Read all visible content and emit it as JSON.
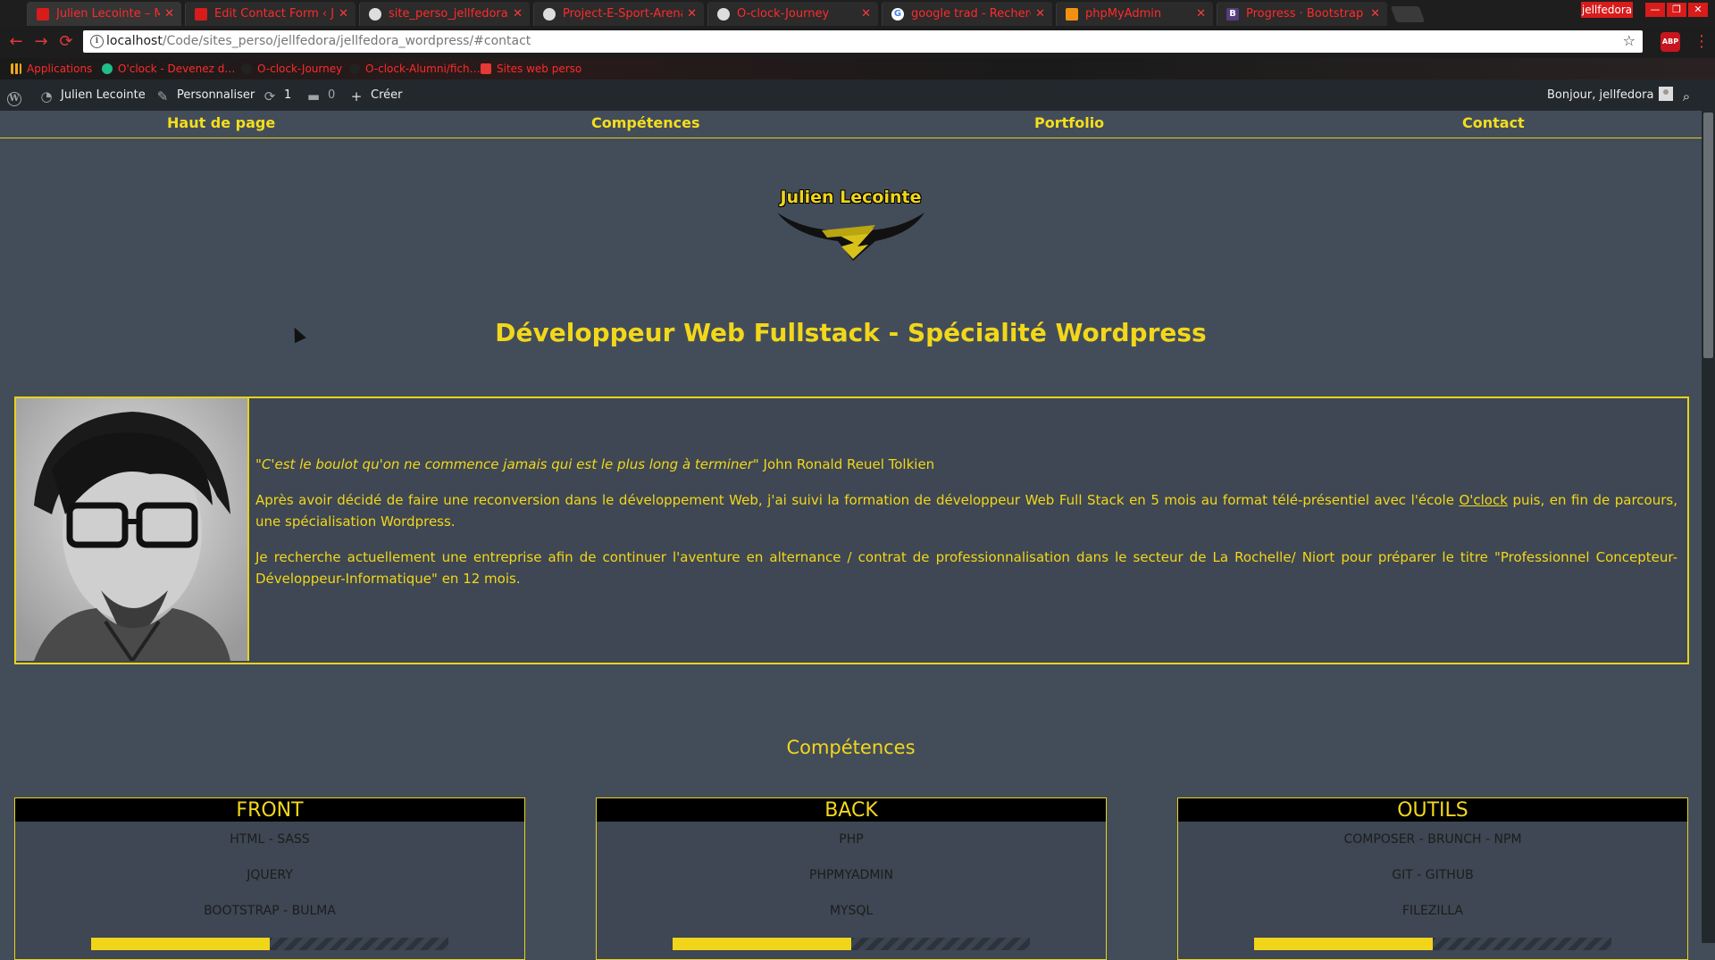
{
  "browser": {
    "tabs": [
      {
        "label": "Julien Lecointe – Mon site",
        "color": "#d81b1b"
      },
      {
        "label": "Edit Contact Form ‹ Julien",
        "color": "#d81b1b"
      },
      {
        "label": "site_perso_jellfedora/jellf",
        "color": "#dddddd"
      },
      {
        "label": "Project-E-Sport-Arena/",
        "color": "#dddddd"
      },
      {
        "label": "O-clock-Journey",
        "color": "#dddddd"
      },
      {
        "label": "google trad - Recherche",
        "color": "#4285f4"
      },
      {
        "label": "phpMyAdmin",
        "color": "#f29111"
      },
      {
        "label": "Progress · Bootstrap",
        "color": "#563d7c"
      }
    ],
    "profile": "jellfedora",
    "url_host": "localhost",
    "url_path": "/Code/sites_perso/jellfedora/jellfedora_wordpress/#contact",
    "abp_label": "ABP",
    "bookmarks": [
      {
        "label": "Applications",
        "color": "#f2a71b"
      },
      {
        "label": "O'clock - Devenez d…",
        "color": "#1ebd8a"
      },
      {
        "label": "O-clock-Journey",
        "color": "#222222"
      },
      {
        "label": "O-clock-Alumni/fich…",
        "color": "#222222"
      },
      {
        "label": "Sites web perso",
        "color": "#e53935"
      }
    ]
  },
  "adminbar": {
    "site_name": "Julien Lecointe",
    "customize": "Personnaliser",
    "updates": "1",
    "comments": "0",
    "create": "Créer",
    "greeting": "Bonjour, jellfedora"
  },
  "nav": {
    "items": [
      "Haut de page",
      "Compétences",
      "Portfolio",
      "Contact"
    ]
  },
  "logo_text": "Julien Lecointe",
  "headline": "Développeur Web Fullstack - Spécialité Wordpress",
  "bio": {
    "quote": "\"C'est le boulot qu'on ne commence jamais qui est le plus long à terminer\"",
    "quote_author": " John Ronald Reuel Tolkien",
    "para1_before": "Après avoir décidé de faire une reconversion dans le développement Web, j'ai suivi la formation de développeur Web Full Stack en 5 mois au format télé-présentiel avec l'école ",
    "para1_link": "O'clock",
    "para1_after": " puis, en fin de parcours, une spécialisation Wordpress.",
    "para2": "Je recherche actuellement une entreprise afin de continuer l'aventure en alternance / contrat de professionnalisation dans le secteur de La Rochelle/ Niort pour préparer le titre \"Professionnel Concepteur-Développeur-Informatique\" en 12 mois."
  },
  "skills": {
    "title": "Compétences",
    "cards": [
      {
        "title": "FRONT",
        "items": [
          "HTML - SASS",
          "JQUERY",
          "BOOTSTRAP - BULMA"
        ],
        "progress": 0.5
      },
      {
        "title": "BACK",
        "items": [
          "PHP",
          "PHPMYADMIN",
          "MYSQL"
        ],
        "progress": 0.5
      },
      {
        "title": "OUTILS",
        "items": [
          "COMPOSER - BRUNCH - NPM",
          "GIT - GITHUB",
          "FILEZILLA"
        ],
        "progress": 0.5
      }
    ]
  },
  "colors": {
    "accent": "#f2d71a",
    "page_bg": "#434d5a",
    "adminbar_bg": "#23282d"
  }
}
